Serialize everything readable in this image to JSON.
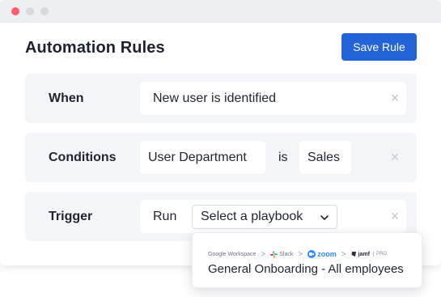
{
  "header": {
    "title": "Automation Rules",
    "save_label": "Save Rule"
  },
  "rules": {
    "when": {
      "label": "When",
      "value": "New user is identified",
      "remove": "×"
    },
    "conditions": {
      "label": "Conditions",
      "field": "User Department",
      "operator": "is",
      "value": "Sales",
      "remove": "×"
    },
    "trigger": {
      "label": "Trigger",
      "action": "Run",
      "playbook_select": "Select a playbook",
      "remove": "×"
    }
  },
  "playbook_popup": {
    "integrations": {
      "google": "Google Workspace",
      "slack": "Slack",
      "zoom": "zoom",
      "jamf": "jamf",
      "jamf_suffix": "PRO",
      "separator": ">"
    },
    "title": "General Onboarding - All employees"
  },
  "colors": {
    "accent": "#2264d8",
    "row_background": "#f4f5f8",
    "close_dot": "#ff5f6d",
    "zoom_blue": "#2d8cff"
  },
  "icons": {
    "remove": "close-icon",
    "select": "chevron-down-icon"
  }
}
